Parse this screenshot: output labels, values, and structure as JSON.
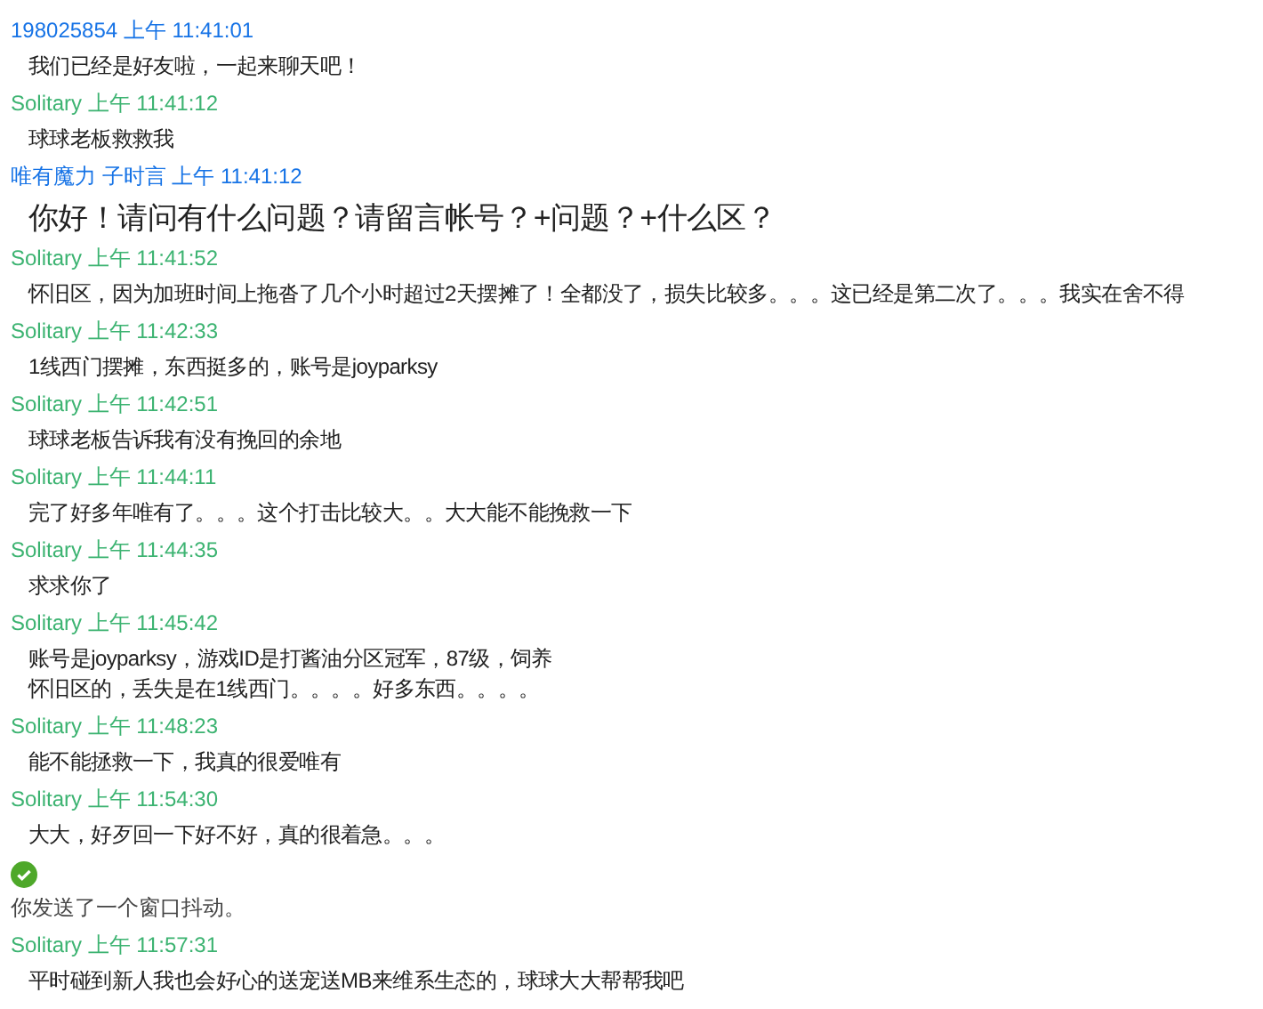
{
  "messages": [
    {
      "kind": "text",
      "sender": "198025854",
      "time": "上午 11:41:01",
      "color": "#1673e6",
      "text": "我们已经是好友啦，一起来聊天吧！"
    },
    {
      "kind": "text",
      "sender": "Solitary",
      "time": "上午 11:41:12",
      "color": "#3cb371",
      "text": "球球老板救救我"
    },
    {
      "kind": "large",
      "sender": "唯有魔力 子时言",
      "time": "上午 11:41:12",
      "color": "#1673e6",
      "text": "你好！请问有什么问题？请留言帐号？+问题？+什么区？"
    },
    {
      "kind": "text",
      "sender": "Solitary",
      "time": "上午 11:41:52",
      "color": "#3cb371",
      "text": "怀旧区，因为加班时间上拖沓了几个小时超过2天摆摊了！全都没了，损失比较多。。。这已经是第二次了。。。我实在舍不得"
    },
    {
      "kind": "text",
      "sender": "Solitary",
      "time": "上午 11:42:33",
      "color": "#3cb371",
      "text": "1线西门摆摊，东西挺多的，账号是joyparksy"
    },
    {
      "kind": "text",
      "sender": "Solitary",
      "time": "上午 11:42:51",
      "color": "#3cb371",
      "text": "球球老板告诉我有没有挽回的余地"
    },
    {
      "kind": "text",
      "sender": "Solitary",
      "time": "上午 11:44:11",
      "color": "#3cb371",
      "text": "完了好多年唯有了。。。这个打击比较大。。大大能不能挽救一下"
    },
    {
      "kind": "text",
      "sender": "Solitary",
      "time": "上午 11:44:35",
      "color": "#3cb371",
      "text": "求求你了"
    },
    {
      "kind": "text",
      "sender": "Solitary",
      "time": "上午 11:45:42",
      "color": "#3cb371",
      "text": "账号是joyparksy，游戏ID是打酱油分区冠军，87级，饲养",
      "continuation": "怀旧区的，丢失是在1线西门。。。。好多东西。。。。"
    },
    {
      "kind": "text",
      "sender": "Solitary",
      "time": "上午 11:48:23",
      "color": "#3cb371",
      "text": "能不能拯救一下，我真的很爱唯有"
    },
    {
      "kind": "text",
      "sender": "Solitary",
      "time": "上午 11:54:30",
      "color": "#3cb371",
      "text": "大大，好歹回一下好不好，真的很着急。。。"
    },
    {
      "kind": "system",
      "text": "你发送了一个窗口抖动。"
    },
    {
      "kind": "text",
      "sender": "Solitary",
      "time": "上午 11:57:31",
      "color": "#3cb371",
      "text": "平时碰到新人我也会好心的送宠送MB来维系生态的，球球大大帮帮我吧"
    }
  ]
}
